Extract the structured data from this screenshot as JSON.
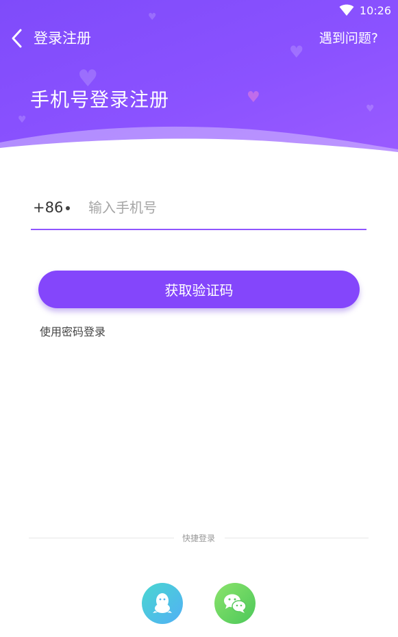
{
  "status_bar": {
    "time": "10:26",
    "wifi_icon": "wifi-icon"
  },
  "topbar": {
    "back_icon": "chevron-left-icon",
    "title": "登录注册",
    "help_link": "遇到问题?"
  },
  "page_title": "手机号登录注册",
  "phone": {
    "country_code": "+86",
    "placeholder": "输入手机号",
    "value": ""
  },
  "get_code_button": "获取验证码",
  "password_login_link": "使用密码登录",
  "quick_login": {
    "label": "快捷登录",
    "providers": [
      {
        "icon": "qq-icon",
        "color": "#4fc4e8"
      },
      {
        "icon": "wechat-icon",
        "color": "#5fd45e"
      }
    ]
  },
  "colors": {
    "accent": "#8446fb",
    "header_gradient_start": "#7f4bfa",
    "header_gradient_end": "#9b5cff"
  }
}
